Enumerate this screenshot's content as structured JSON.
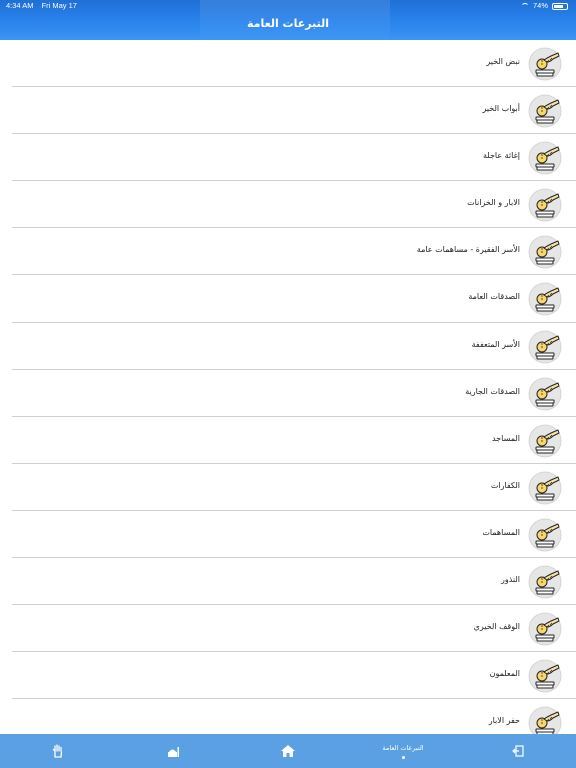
{
  "status": {
    "time": "4:34 AM",
    "date": "Fri May 17",
    "battery": "74%"
  },
  "header": {
    "title": "التبرعات العامة"
  },
  "list": {
    "items": [
      {
        "label": "نبض الخير",
        "icon": "donation-box-icon"
      },
      {
        "label": "أبواب الخير",
        "icon": "donation-box-icon"
      },
      {
        "label": "إغاثة عاجلة",
        "icon": "donation-box-icon"
      },
      {
        "label": "الابار و الخزانات",
        "icon": "donation-box-icon"
      },
      {
        "label": "الأسر الفقيرة - مساهمات عامة",
        "icon": "donation-box-icon"
      },
      {
        "label": "الصدقات العامة",
        "icon": "donation-box-icon"
      },
      {
        "label": "الأسر المتعففة",
        "icon": "donation-box-icon"
      },
      {
        "label": "الصدقات الجارية",
        "icon": "donation-box-icon"
      },
      {
        "label": "المساجد",
        "icon": "donation-box-icon"
      },
      {
        "label": "الكفارات",
        "icon": "donation-box-icon"
      },
      {
        "label": "المساهمات",
        "icon": "donation-box-icon"
      },
      {
        "label": "النذور",
        "icon": "donation-box-icon"
      },
      {
        "label": "الوقف الخيري",
        "icon": "donation-box-icon"
      },
      {
        "label": "المعلمون",
        "icon": "donation-box-icon"
      },
      {
        "label": "حفر الابار",
        "icon": "donation-box-icon"
      }
    ]
  },
  "tabbar": {
    "tabs": [
      {
        "icon": "hand-icon",
        "label": ""
      },
      {
        "icon": "mosque-icon",
        "label": ""
      },
      {
        "icon": "home-icon",
        "label": ""
      },
      {
        "icon": "",
        "label": "التبرعات العامة",
        "active": true
      },
      {
        "icon": "logout-icon",
        "label": ""
      }
    ]
  },
  "colors": {
    "header": "#2a86ee",
    "tabbar": "#5aa0e2",
    "icon_fill": "#f5d76e",
    "separator": "#cfcfcf"
  }
}
